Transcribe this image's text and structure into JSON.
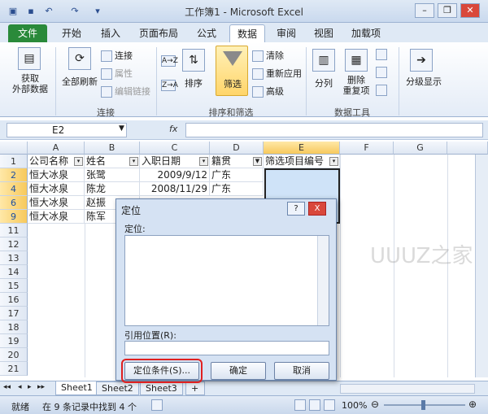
{
  "window": {
    "title": "工作簿1 - Microsoft Excel"
  },
  "tabs": [
    "文件",
    "开始",
    "插入",
    "页面布局",
    "公式",
    "数据",
    "审阅",
    "视图",
    "加载项"
  ],
  "ribbon": {
    "get_external": "获取\n外部数据",
    "refresh_all": "全部刷新",
    "connections": "连接",
    "properties": "属性",
    "edit_links": "编辑链接",
    "group_connections": "连接",
    "sort": "排序",
    "filter": "筛选",
    "clear": "清除",
    "reapply": "重新应用",
    "advanced": "高级",
    "group_sortfilter": "排序和筛选",
    "text_to_columns": "分列",
    "remove_duplicates": "删除\n重复项",
    "group_datatools": "数据工具",
    "outline": "分级显示",
    "sort_az_icon": "A→Z",
    "sort_za_icon": "Z→A"
  },
  "formula_bar": {
    "namebox": "E2",
    "fx": "fx",
    "value": ""
  },
  "columns": [
    "A",
    "B",
    "C",
    "D",
    "E",
    "F",
    "G"
  ],
  "rows": [
    {
      "num": "1",
      "cells": [
        "公司名称",
        "姓名",
        "入职日期",
        "籍贯",
        "筛选项目编号",
        "",
        ""
      ]
    },
    {
      "num": "2",
      "cells": [
        "恒大冰泉",
        "张鹭",
        "2009/9/12",
        "广东",
        "",
        "",
        ""
      ]
    },
    {
      "num": "4",
      "cells": [
        "恒大冰泉",
        "陈龙",
        "2008/11/29",
        "广东",
        "",
        "",
        ""
      ]
    },
    {
      "num": "6",
      "cells": [
        "恒大冰泉",
        "赵振",
        "",
        "",
        "",
        "",
        ""
      ]
    },
    {
      "num": "9",
      "cells": [
        "恒大冰泉",
        "陈军",
        "",
        "",
        "",
        "",
        ""
      ]
    },
    {
      "num": "11",
      "cells": [
        "",
        "",
        "",
        "",
        "",
        "",
        ""
      ]
    },
    {
      "num": "12",
      "cells": [
        "",
        "",
        "",
        "",
        "",
        "",
        ""
      ]
    },
    {
      "num": "13",
      "cells": [
        "",
        "",
        "",
        "",
        "",
        "",
        ""
      ]
    },
    {
      "num": "14",
      "cells": [
        "",
        "",
        "",
        "",
        "",
        "",
        ""
      ]
    },
    {
      "num": "15",
      "cells": [
        "",
        "",
        "",
        "",
        "",
        "",
        ""
      ]
    },
    {
      "num": "16",
      "cells": [
        "",
        "",
        "",
        "",
        "",
        "",
        ""
      ]
    },
    {
      "num": "17",
      "cells": [
        "",
        "",
        "",
        "",
        "",
        "",
        ""
      ]
    },
    {
      "num": "18",
      "cells": [
        "",
        "",
        "",
        "",
        "",
        "",
        ""
      ]
    },
    {
      "num": "19",
      "cells": [
        "",
        "",
        "",
        "",
        "",
        "",
        ""
      ]
    },
    {
      "num": "20",
      "cells": [
        "",
        "",
        "",
        "",
        "",
        "",
        ""
      ]
    },
    {
      "num": "21",
      "cells": [
        "",
        "",
        "",
        "",
        "",
        "",
        ""
      ]
    }
  ],
  "sheets": [
    "Sheet1",
    "Sheet2",
    "Sheet3"
  ],
  "status": {
    "ready": "就绪",
    "found": "在 9 条记录中找到 4 个",
    "zoom": "100%"
  },
  "dialog": {
    "title": "定位",
    "list_label": "定位:",
    "ref_label": "引用位置(R):",
    "special_button": "定位条件(S)...",
    "ok_button": "确定",
    "cancel_button": "取消",
    "help": "?",
    "close": "X"
  },
  "watermark": "UUUZ之家",
  "colors": {
    "file_tab": "#2a8a3a",
    "selection": "#cfe3f8",
    "highlight_outline": "#e02020"
  }
}
